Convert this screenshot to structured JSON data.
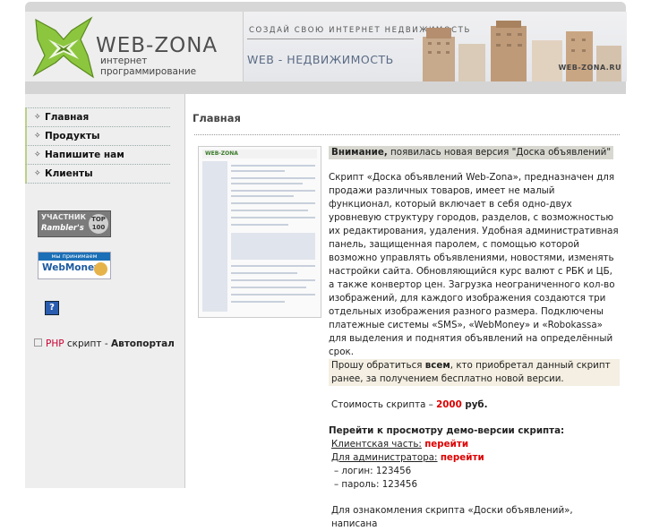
{
  "header": {
    "logo_text": "WEB-ZONA",
    "logo_subtitle": "интернет программирование",
    "banner_tagline": "СОЗДАЙ СВОЮ ИНТЕРНЕТ НЕДВИЖИМОСТЬ",
    "banner_title": "WEB - НЕДВИЖИМОСТЬ",
    "banner_url": "WEB-ZONA.RU"
  },
  "sidebar": {
    "menu": [
      {
        "label": "Главная"
      },
      {
        "label": "Продукты"
      },
      {
        "label": "Напишите нам"
      },
      {
        "label": "Клиенты"
      }
    ],
    "rambler": {
      "line1": "УЧАСТНИК",
      "line2": "Rambler's",
      "top": "TOP 100"
    },
    "webmoney": {
      "line1": "мы принимаем",
      "line2": "WebMoney"
    },
    "help": "?",
    "php_link": {
      "php": "PHP",
      "middle": " скрипт - ",
      "name": "Автопортал"
    }
  },
  "main": {
    "title": "Главная",
    "notice_bold": "Внимание,",
    "notice_rest": " появилась новая версия \"Доска объявлений\"",
    "description": "Скрипт «Доска объявлений Web-Zona», предназначен для продажи различных товаров, имеет не малый функционал, который включает в себя одно-двух уровневую структуру городов, разделов, с возможностью их редактирования, удаления. Удобная административная панель, защищенная паролем, с помощью которой возможно управлять объявлениями, новостями, изменять настройки сайта. Обновляющийся курс валют с РБК и ЦБ, а также конвертор цен. Загрузка неограниченного кол-во изображений, для каждого изображения создаются три отдельных изображения разного размера. Подключены платежные системы «SMS», «WebMoney» и «Robokassa» для выделения и поднятия объявлений на определённый срок.",
    "request_pre": "Прошу обратиться ",
    "request_bold": "всем",
    "request_post": ", кто приобретал данный скрипт ранее, за получением бесплатно новой версии.",
    "price_label": "Стоимость скрипта – ",
    "price_value": "2000",
    "price_currency": " руб.",
    "demo_heading": "Перейти к просмотру демо-версии скрипта:",
    "client_label": "Клиентская часть:",
    "client_link": "перейти",
    "admin_label": "Для администратора:",
    "admin_link": "перейти",
    "login": "– логин: 123456",
    "password": "– пароль: 123456",
    "more": "Для ознакомления скрипта «Доски объявлений», написана"
  },
  "colors": {
    "accent_green": "#7ab51d",
    "red": "#dd0000",
    "sidebar_bg": "#eeeeee"
  },
  "icons": [
    "logo-x-icon",
    "menu-bullet-icon",
    "help-icon",
    "square-bullet-icon"
  ]
}
